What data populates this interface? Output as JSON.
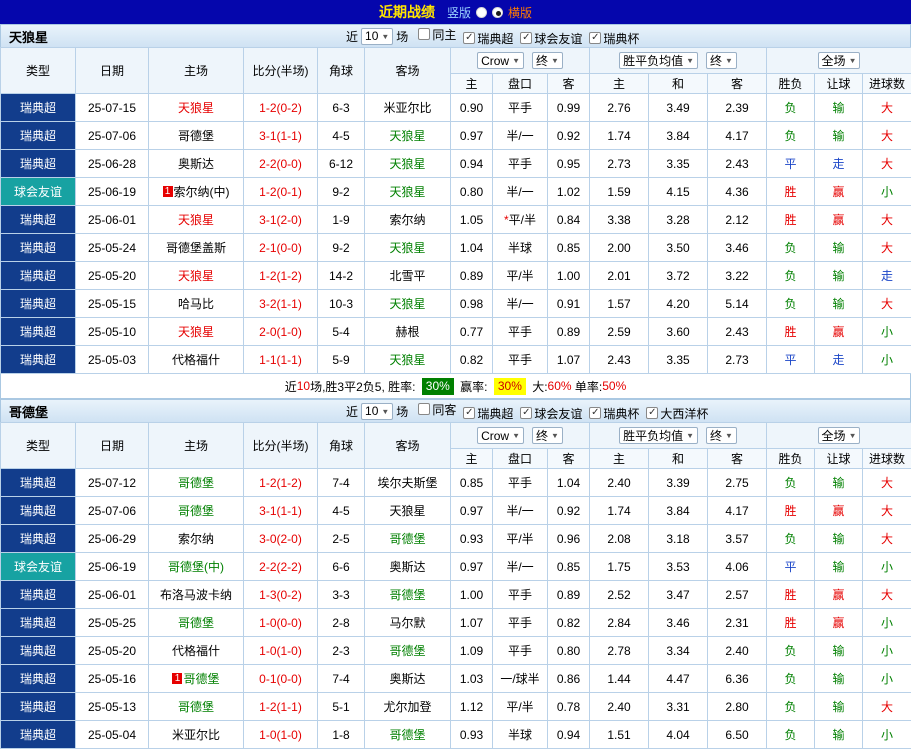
{
  "topbar": {
    "title": "近期战绩",
    "vertical": "竖版",
    "horizontal": "横版"
  },
  "colors": {
    "topbar_bg": "#0506ac",
    "title_yellow": "#ffe400",
    "vertical_label": "#9bd2ff",
    "horizontal_label": "#ff7b00",
    "league_swedish": "#123d8c",
    "league_friendly": "#17a2a2",
    "home_red": "#e60000",
    "away_green": "#008000",
    "score": "#e60000",
    "result_win": "#e60000",
    "result_draw": "#1b46c8",
    "result_lose": "#008000",
    "badge_green_bg": "#008000",
    "badge_yellow_bg": "#ffff00"
  },
  "table_header": {
    "type": "类型",
    "date": "日期",
    "home": "主场",
    "score": "比分(半场)",
    "corners": "角球",
    "away": "客场",
    "odds_home": "主",
    "odds_handicap": "盘口",
    "odds_away": "客",
    "avg_home": "主",
    "avg_draw": "和",
    "avg_away": "客",
    "result_wdl": "胜负",
    "result_handicap": "让球",
    "result_goals": "进球数",
    "bookmaker_select": "Crow",
    "final_select": "终",
    "avg_select": "胜平负均值",
    "final_select2": "终",
    "scope_select": "全场"
  },
  "sections": [
    {
      "team": "天狼星",
      "filter": {
        "near": "近",
        "count": "10",
        "games": "场",
        "checkboxes": [
          {
            "label": "同主",
            "checked": false
          },
          {
            "label": "瑞典超",
            "checked": true
          },
          {
            "label": "球会友谊",
            "checked": true
          },
          {
            "label": "瑞典杯",
            "checked": true
          }
        ]
      },
      "rows": [
        {
          "league": "瑞典超",
          "date": "25-07-15",
          "home": "天狼星",
          "hc": "red",
          "score": "1-2(0-2)",
          "corners": "6-3",
          "away": "米亚尔比",
          "ac": "black",
          "o1": "0.90",
          "hcp": "平手",
          "o2": "0.99",
          "a1": "2.76",
          "a2": "3.49",
          "a3": "2.39",
          "r1": "负",
          "r2": "输",
          "r3": "大"
        },
        {
          "league": "瑞典超",
          "date": "25-07-06",
          "home": "哥德堡",
          "hc": "black",
          "score": "3-1(1-1)",
          "corners": "4-5",
          "away": "天狼星",
          "ac": "green",
          "o1": "0.97",
          "hcp": "半/一",
          "o2": "0.92",
          "a1": "1.74",
          "a2": "3.84",
          "a3": "4.17",
          "r1": "负",
          "r2": "输",
          "r3": "大"
        },
        {
          "league": "瑞典超",
          "date": "25-06-28",
          "home": "奥斯达",
          "hc": "black",
          "score": "2-2(0-0)",
          "corners": "6-12",
          "away": "天狼星",
          "ac": "green",
          "o1": "0.94",
          "hcp": "平手",
          "o2": "0.95",
          "a1": "2.73",
          "a2": "3.35",
          "a3": "2.43",
          "r1": "平",
          "r2": "走",
          "r3": "大"
        },
        {
          "league": "球会友谊",
          "date": "25-06-19",
          "home": "索尔纳(中)",
          "hc": "black",
          "hb": "1",
          "score": "1-2(0-1)",
          "corners": "9-2",
          "away": "天狼星",
          "ac": "green",
          "o1": "0.80",
          "hcp": "半/一",
          "o2": "1.02",
          "a1": "1.59",
          "a2": "4.15",
          "a3": "4.36",
          "r1": "胜",
          "r2": "赢",
          "r3": "小"
        },
        {
          "league": "瑞典超",
          "date": "25-06-01",
          "home": "天狼星",
          "hc": "red",
          "score": "3-1(2-0)",
          "corners": "1-9",
          "away": "索尔纳",
          "ac": "black",
          "o1": "1.05",
          "hcp": "*平/半",
          "o2": "0.84",
          "a1": "3.38",
          "a2": "3.28",
          "a3": "2.12",
          "r1": "胜",
          "r2": "赢",
          "r3": "大"
        },
        {
          "league": "瑞典超",
          "date": "25-05-24",
          "home": "哥德堡盖斯",
          "hc": "black",
          "score": "2-1(0-0)",
          "corners": "9-2",
          "away": "天狼星",
          "ac": "green",
          "o1": "1.04",
          "hcp": "半球",
          "o2": "0.85",
          "a1": "2.00",
          "a2": "3.50",
          "a3": "3.46",
          "r1": "负",
          "r2": "输",
          "r3": "大"
        },
        {
          "league": "瑞典超",
          "date": "25-05-20",
          "home": "天狼星",
          "hc": "red",
          "score": "1-2(1-2)",
          "corners": "14-2",
          "away": "北雪平",
          "ac": "black",
          "o1": "0.89",
          "hcp": "平/半",
          "o2": "1.00",
          "a1": "2.01",
          "a2": "3.72",
          "a3": "3.22",
          "r1": "负",
          "r2": "输",
          "r3": "走"
        },
        {
          "league": "瑞典超",
          "date": "25-05-15",
          "home": "哈马比",
          "hc": "black",
          "score": "3-2(1-1)",
          "corners": "10-3",
          "away": "天狼星",
          "ac": "green",
          "o1": "0.98",
          "hcp": "半/一",
          "o2": "0.91",
          "a1": "1.57",
          "a2": "4.20",
          "a3": "5.14",
          "r1": "负",
          "r2": "输",
          "r3": "大"
        },
        {
          "league": "瑞典超",
          "date": "25-05-10",
          "home": "天狼星",
          "hc": "red",
          "score": "2-0(1-0)",
          "corners": "5-4",
          "away": "赫根",
          "ac": "black",
          "o1": "0.77",
          "hcp": "平手",
          "o2": "0.89",
          "a1": "2.59",
          "a2": "3.60",
          "a3": "2.43",
          "r1": "胜",
          "r2": "赢",
          "r3": "小"
        },
        {
          "league": "瑞典超",
          "date": "25-05-03",
          "home": "代格福什",
          "hc": "black",
          "score": "1-1(1-1)",
          "corners": "5-9",
          "away": "天狼星",
          "ac": "green",
          "o1": "0.82",
          "hcp": "平手",
          "o2": "1.07",
          "a1": "2.43",
          "a2": "3.35",
          "a3": "2.73",
          "r1": "平",
          "r2": "走",
          "r3": "小"
        }
      ],
      "summary_parts": [
        {
          "text": "近",
          "color": "#000000"
        },
        {
          "text": "10",
          "color": "#e60000"
        },
        {
          "text": "场,胜3平2负5, 胜率: ",
          "color": "#000000"
        },
        {
          "text": "30%",
          "color": "#ffffff",
          "bg": "#008000"
        },
        {
          "text": " 赢率: ",
          "color": "#000000"
        },
        {
          "text": "30%",
          "color": "#cc0000",
          "bg": "#ffff00"
        },
        {
          "text": " 大:",
          "color": "#000000"
        },
        {
          "text": "60%",
          "color": "#e60000"
        },
        {
          "text": " 单率:",
          "color": "#000000"
        },
        {
          "text": "50%",
          "color": "#e60000"
        }
      ]
    },
    {
      "team": "哥德堡",
      "filter": {
        "near": "近",
        "count": "10",
        "games": "场",
        "checkboxes": [
          {
            "label": "同客",
            "checked": false
          },
          {
            "label": "瑞典超",
            "checked": true
          },
          {
            "label": "球会友谊",
            "checked": true
          },
          {
            "label": "瑞典杯",
            "checked": true
          },
          {
            "label": "大西洋杯",
            "checked": true
          }
        ]
      },
      "rows": [
        {
          "league": "瑞典超",
          "date": "25-07-12",
          "home": "哥德堡",
          "hc": "green",
          "score": "1-2(1-2)",
          "corners": "7-4",
          "away": "埃尔夫斯堡",
          "ac": "black",
          "o1": "0.85",
          "hcp": "平手",
          "o2": "1.04",
          "a1": "2.40",
          "a2": "3.39",
          "a3": "2.75",
          "r1": "负",
          "r2": "输",
          "r3": "大"
        },
        {
          "league": "瑞典超",
          "date": "25-07-06",
          "home": "哥德堡",
          "hc": "green",
          "score": "3-1(1-1)",
          "corners": "4-5",
          "away": "天狼星",
          "ac": "black",
          "o1": "0.97",
          "hcp": "半/一",
          "o2": "0.92",
          "a1": "1.74",
          "a2": "3.84",
          "a3": "4.17",
          "r1": "胜",
          "r2": "赢",
          "r3": "大"
        },
        {
          "league": "瑞典超",
          "date": "25-06-29",
          "home": "索尔纳",
          "hc": "black",
          "score": "3-0(2-0)",
          "corners": "2-5",
          "away": "哥德堡",
          "ac": "green",
          "o1": "0.93",
          "hcp": "平/半",
          "o2": "0.96",
          "a1": "2.08",
          "a2": "3.18",
          "a3": "3.57",
          "r1": "负",
          "r2": "输",
          "r3": "大"
        },
        {
          "league": "球会友谊",
          "date": "25-06-19",
          "home": "哥德堡(中)",
          "hc": "green",
          "score": "2-2(2-2)",
          "corners": "6-6",
          "away": "奥斯达",
          "ac": "black",
          "o1": "0.97",
          "hcp": "半/一",
          "o2": "0.85",
          "a1": "1.75",
          "a2": "3.53",
          "a3": "4.06",
          "r1": "平",
          "r2": "输",
          "r3": "小"
        },
        {
          "league": "瑞典超",
          "date": "25-06-01",
          "home": "布洛马波卡纳",
          "hc": "black",
          "score": "1-3(0-2)",
          "corners": "3-3",
          "away": "哥德堡",
          "ac": "green",
          "o1": "1.00",
          "hcp": "平手",
          "o2": "0.89",
          "a1": "2.52",
          "a2": "3.47",
          "a3": "2.57",
          "r1": "胜",
          "r2": "赢",
          "r3": "大"
        },
        {
          "league": "瑞典超",
          "date": "25-05-25",
          "home": "哥德堡",
          "hc": "green",
          "score": "1-0(0-0)",
          "corners": "2-8",
          "away": "马尔默",
          "ac": "black",
          "o1": "1.07",
          "hcp": "平手",
          "o2": "0.82",
          "a1": "2.84",
          "a2": "3.46",
          "a3": "2.31",
          "r1": "胜",
          "r2": "赢",
          "r3": "小"
        },
        {
          "league": "瑞典超",
          "date": "25-05-20",
          "home": "代格福什",
          "hc": "black",
          "score": "1-0(1-0)",
          "corners": "2-3",
          "away": "哥德堡",
          "ac": "green",
          "o1": "1.09",
          "hcp": "平手",
          "o2": "0.80",
          "a1": "2.78",
          "a2": "3.34",
          "a3": "2.40",
          "r1": "负",
          "r2": "输",
          "r3": "小"
        },
        {
          "league": "瑞典超",
          "date": "25-05-16",
          "home": "哥德堡",
          "hc": "green",
          "hb": "1",
          "score": "0-1(0-0)",
          "corners": "7-4",
          "away": "奥斯达",
          "ac": "black",
          "o1": "1.03",
          "hcp": "一/球半",
          "o2": "0.86",
          "a1": "1.44",
          "a2": "4.47",
          "a3": "6.36",
          "r1": "负",
          "r2": "输",
          "r3": "小"
        },
        {
          "league": "瑞典超",
          "date": "25-05-13",
          "home": "哥德堡",
          "hc": "green",
          "score": "1-2(1-1)",
          "corners": "5-1",
          "away": "尤尔加登",
          "ac": "black",
          "o1": "1.12",
          "hcp": "平/半",
          "o2": "0.78",
          "a1": "2.40",
          "a2": "3.31",
          "a3": "2.80",
          "r1": "负",
          "r2": "输",
          "r3": "大"
        },
        {
          "league": "瑞典超",
          "date": "25-05-04",
          "home": "米亚尔比",
          "hc": "black",
          "score": "1-0(1-0)",
          "corners": "1-8",
          "away": "哥德堡",
          "ac": "green",
          "o1": "0.93",
          "hcp": "半球",
          "o2": "0.94",
          "a1": "1.51",
          "a2": "4.04",
          "a3": "6.50",
          "r1": "负",
          "r2": "输",
          "r3": "小"
        }
      ]
    }
  ]
}
